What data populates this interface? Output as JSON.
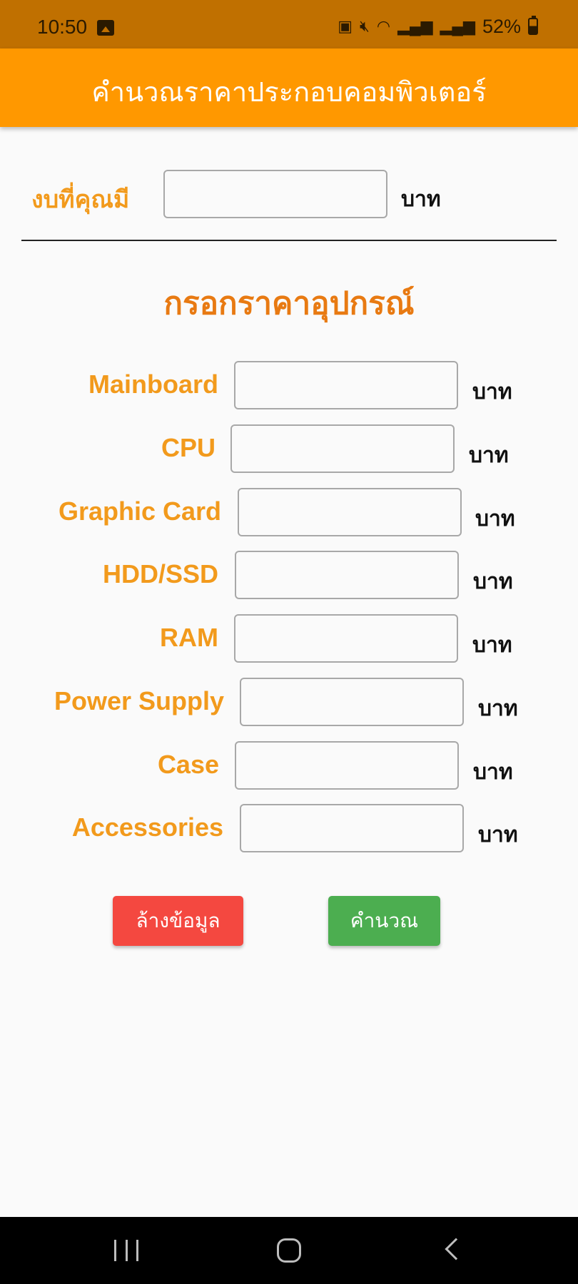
{
  "status_bar": {
    "time": "10:50",
    "battery": "52%",
    "icons": [
      "gallery-icon",
      "battery-saver-icon",
      "mute-icon",
      "wifi-icon",
      "signal-icon",
      "signal-icon",
      "battery-icon"
    ]
  },
  "app_bar": {
    "title": "คำนวณราคาประกอบคอมพิวเตอร์",
    "color": "#ff9800"
  },
  "budget": {
    "label": "งบที่คุณมี",
    "value": "",
    "unit": "บาท"
  },
  "divider_text": "",
  "section_title": "กรอกราคาอุปกรณ์",
  "components": [
    {
      "label": "Mainboard",
      "value": "",
      "unit": "บาท"
    },
    {
      "label": "CPU",
      "value": "",
      "unit": "บาท"
    },
    {
      "label": "Graphic Card",
      "value": "",
      "unit": "บาท"
    },
    {
      "label": "HDD/SSD",
      "value": "",
      "unit": "บาท"
    },
    {
      "label": "RAM",
      "value": "",
      "unit": "บาท"
    },
    {
      "label": "Power Supply",
      "value": "",
      "unit": "บาท"
    },
    {
      "label": "Case",
      "value": "",
      "unit": "บาท"
    },
    {
      "label": "Accessories",
      "value": "",
      "unit": "บาท"
    }
  ],
  "buttons": {
    "clear_label": "ล้างข้อมูล",
    "clear_color": "#f44840",
    "calculate_label": "คำนวณ",
    "calculate_color": "#4cae50"
  },
  "nav_bar": {
    "icons": [
      "recent-apps-icon",
      "home-icon",
      "back-icon"
    ]
  }
}
